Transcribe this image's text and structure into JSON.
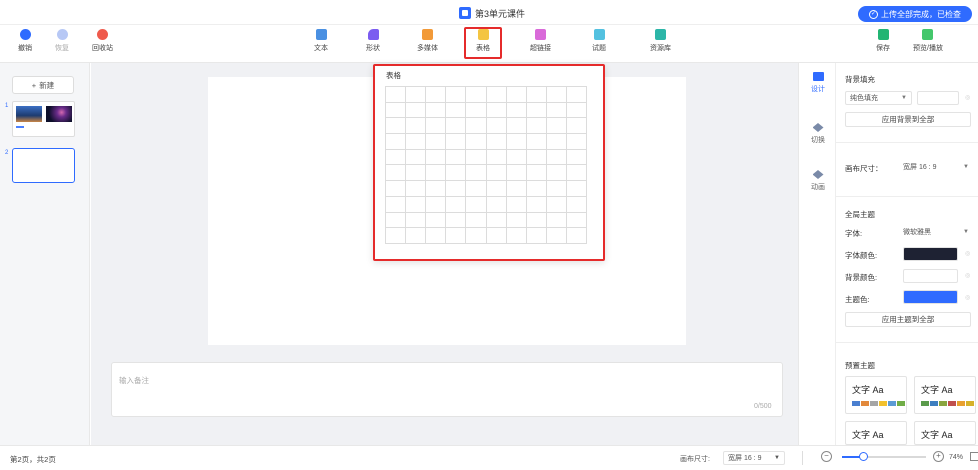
{
  "title": "第3单元课件",
  "upload_status": "上传全部完成，已检查",
  "toolbar": {
    "undo": "撤销",
    "redo": "恢复",
    "recycle": "回收站",
    "text": "文本",
    "shape": "形状",
    "media": "多媒体",
    "table": "表格",
    "hyperlink": "超链接",
    "quiz": "试题",
    "resources": "资源库",
    "save": "保存",
    "preview": "预览/播放"
  },
  "left": {
    "new_label": "新建",
    "slide_numbers": [
      "1",
      "2"
    ]
  },
  "table_popup": {
    "title": "表格",
    "rows": 10,
    "cols": 10
  },
  "notes": {
    "placeholder": "输入备注",
    "counter": "0/500"
  },
  "right_tabs": {
    "design": "设计",
    "transition": "切换",
    "animation": "动画"
  },
  "design": {
    "bg_fill_label": "背景填充",
    "bg_fill_value": "纯色填充",
    "apply_bg_all": "应用背景到全部",
    "canvas_size_label": "画布尺寸：",
    "canvas_size_value": "宽屏 16 : 9",
    "global_theme_label": "全局主题",
    "font_label": "字体:",
    "font_value": "微软雅黑",
    "font_color_label": "字体颜色:",
    "bg_color_label": "背景颜色:",
    "theme_color_label": "主题色:",
    "apply_theme_all": "应用主题到全部",
    "preset_theme_label": "预置主题",
    "theme_card_text": "文字 Aa"
  },
  "colors": {
    "accent": "#2f6bff",
    "highlight": "#e52b2b",
    "font_color": "#1e2233",
    "bg_color": "#ffffff",
    "theme_color": "#2f6bff"
  },
  "statusbar": {
    "page_info": "第2页，共2页",
    "canvas_size_label": "画布尺寸:",
    "canvas_size_value": "宽屏 16 : 9",
    "zoom": "74%",
    "zoom_fraction": 0.25
  }
}
